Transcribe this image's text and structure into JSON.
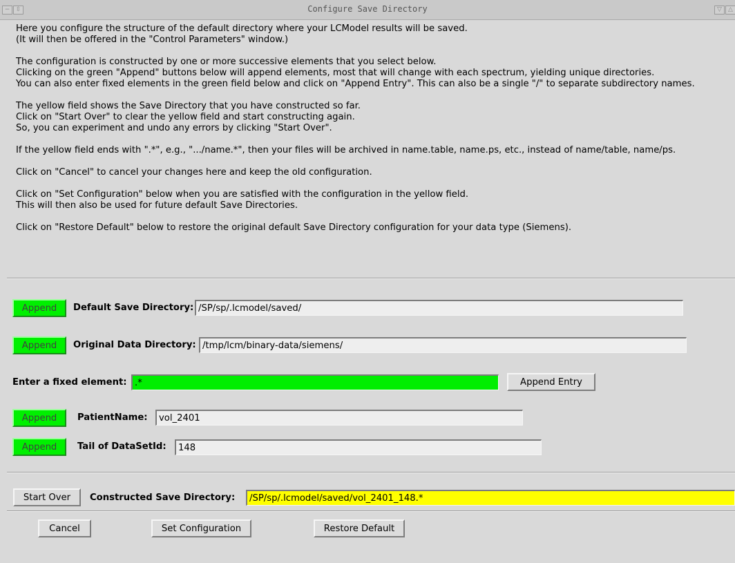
{
  "window": {
    "title": "Configure Save Directory",
    "left_buttons": [
      "−",
      "⇳"
    ],
    "right_buttons": [
      "▽",
      "△"
    ]
  },
  "instructions": [
    [
      "Here you configure the structure of the default directory where your LCModel results will be saved.",
      "(It will then be offered in the \"Control Parameters\" window.)"
    ],
    [
      "The configuration is constructed by one or more successive elements that you select below.",
      "Clicking on the green \"Append\" buttons below will append elements, most that will change with each spectrum, yielding unique directories.",
      "You can also enter fixed elements in the green field below and click on \"Append Entry\".  This can also be a single \"/\" to separate subdirectory names."
    ],
    [
      "The yellow field shows the Save Directory that you have constructed so far.",
      "Click on \"Start Over\" to clear the yellow field and start constructing again.",
      "So, you can experiment and undo any errors by clicking \"Start Over\"."
    ],
    [
      "If the yellow field ends with \".*\", e.g., \".../name.*\", then your files  will be archived in name.table, name.ps, etc., instead of name/table, name/ps."
    ],
    [
      "Click on \"Cancel\" to cancel your changes here and keep the old configuration."
    ],
    [
      "Click on \"Set Configuration\" below when you are satisfied with the configuration in the yellow field.",
      "This will then also be used for future default Save Directories."
    ],
    [
      "Click on \"Restore Default\" below to restore the original default  Save Directory configuration for your data type (Siemens)."
    ]
  ],
  "rows": {
    "default_save": {
      "button": "Append",
      "label": "Default Save Directory:",
      "value": "/SP/sp/.lcmodel/saved/"
    },
    "original_data": {
      "button": "Append",
      "label": "Original Data Directory:",
      "value": "/tmp/lcm/binary-data/siemens/"
    },
    "fixed_element": {
      "label": "Enter a fixed element:",
      "value": ".*",
      "button": "Append Entry"
    },
    "patient_name": {
      "button": "Append",
      "label": "PatientName:",
      "value": "vol_2401"
    },
    "dataset_tail": {
      "button": "Append",
      "label": "Tail of DataSetId:",
      "value": "148"
    }
  },
  "constructed": {
    "button": "Start Over",
    "label": "Constructed Save Directory:",
    "value": "/SP/sp/.lcmodel/saved/vol_2401_148.*"
  },
  "footer": {
    "cancel": "Cancel",
    "set_configuration": "Set Configuration",
    "restore_default": "Restore Default"
  },
  "colors": {
    "background": "#d9d9d9",
    "append_green": "#00f000",
    "constructed_yellow": "#ffff00"
  }
}
